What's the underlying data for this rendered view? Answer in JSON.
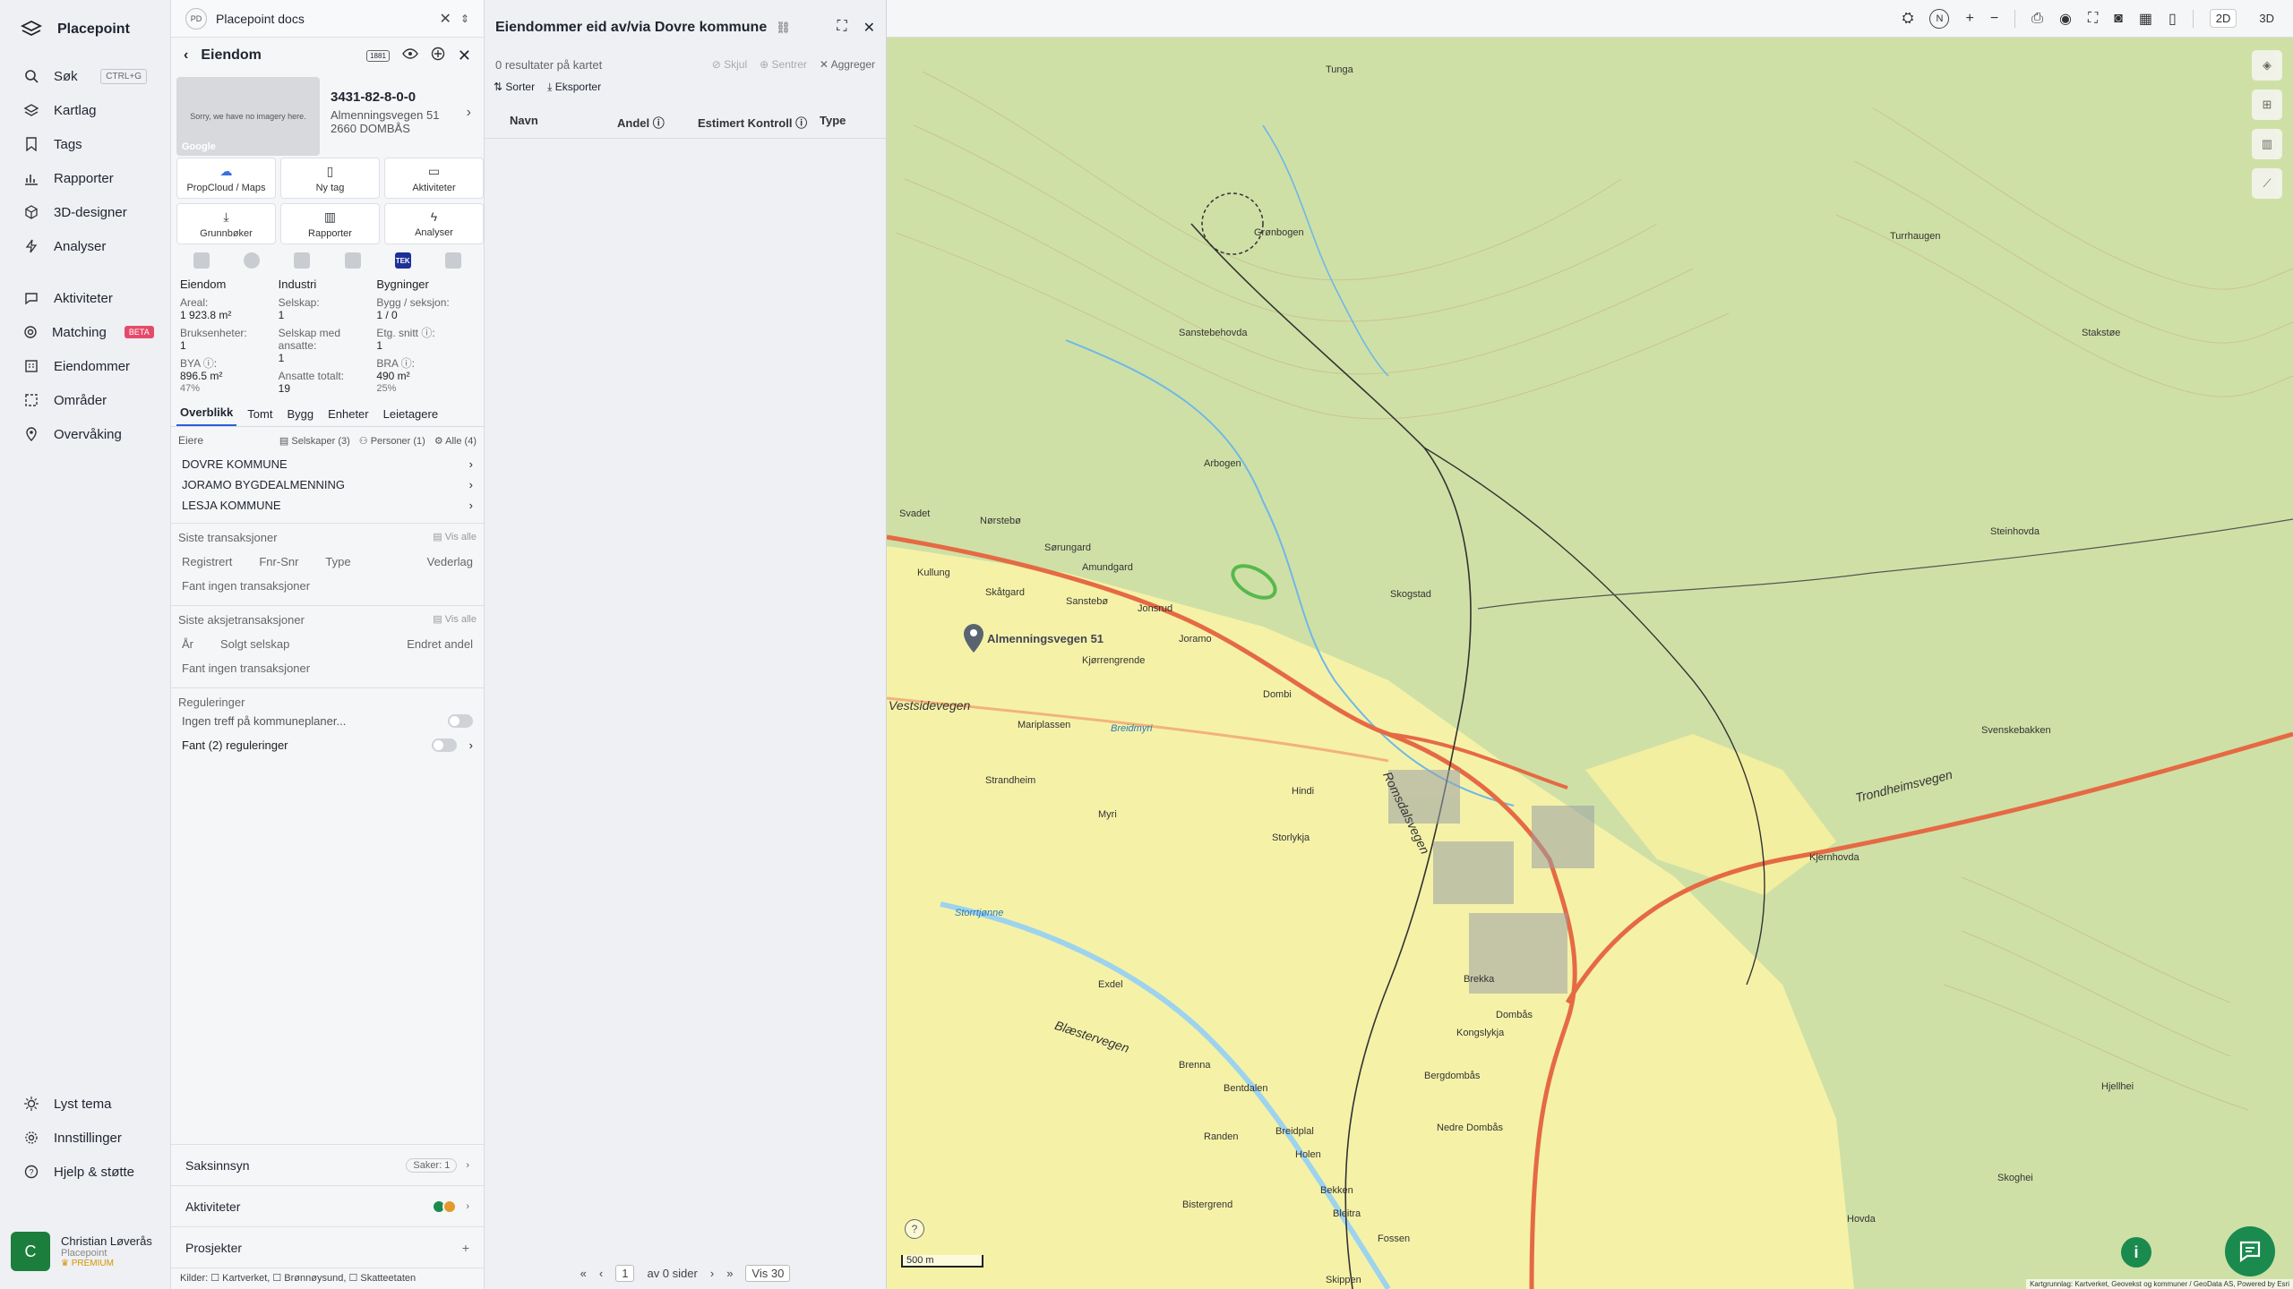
{
  "nav": {
    "brand": "Placepoint",
    "items": [
      {
        "label": "Søk",
        "shortcut": "CTRL+G"
      },
      {
        "label": "Kartlag"
      },
      {
        "label": "Tags"
      },
      {
        "label": "Rapporter"
      },
      {
        "label": "3D-designer"
      },
      {
        "label": "Analyser"
      },
      {
        "label": "Aktiviteter"
      },
      {
        "label": "Matching",
        "badge": "BETA"
      },
      {
        "label": "Eiendommer"
      },
      {
        "label": "Områder"
      },
      {
        "label": "Overvåking"
      }
    ],
    "bottom": [
      {
        "label": "Lyst tema"
      },
      {
        "label": "Innstillinger"
      },
      {
        "label": "Hjelp & støtte"
      }
    ],
    "user": {
      "initial": "C",
      "name": "Christian Løverås",
      "org": "Placepoint",
      "plan": "PREMIUM"
    }
  },
  "docs": {
    "badge": "PD",
    "title": "Placepoint docs"
  },
  "property": {
    "header": "Eiendom",
    "header_badge": "1881",
    "photo_text": "Sorry, we have no imagery here.",
    "photo_google": "Google",
    "id": "3431-82-8-0-0",
    "address_line1": "Almenningsvegen 51",
    "address_line2": "2660 DOMBÅS",
    "actions": [
      {
        "label": "PropCloud / Maps",
        "icon": "cloud-icon"
      },
      {
        "label": "Ny tag",
        "icon": "bookmark-icon"
      },
      {
        "label": "Aktiviteter",
        "icon": "chat-icon"
      },
      {
        "label": "Grunnbøker",
        "icon": "download-icon"
      },
      {
        "label": "Rapporter",
        "icon": "chart-icon"
      },
      {
        "label": "Analyser",
        "icon": "bolt-icon"
      }
    ],
    "logos": [
      "",
      "",
      "",
      "",
      "TEK",
      ""
    ],
    "stats": {
      "eiendom": {
        "header": "Eiendom",
        "areal_label": "Areal:",
        "areal_value": "1 923.8 m²",
        "bruks_label": "Bruksenheter:",
        "bruks_value": "1",
        "bya_label": "BYA ⓘ:",
        "bya_value": "896.5 m²",
        "bya_pct": "47%"
      },
      "industri": {
        "header": "Industri",
        "selskap_label": "Selskap:",
        "selskap_value": "1",
        "ansatte_label": "Selskap med ansatte:",
        "ansatte_value": "1",
        "total_label": "Ansatte totalt:",
        "total_value": "19"
      },
      "bygninger": {
        "header": "Bygninger",
        "bygg_label": "Bygg / seksjon:",
        "bygg_value": "1 / 0",
        "etg_label": "Etg. snitt ⓘ:",
        "etg_value": "1",
        "bra_label": "BRA ⓘ:",
        "bra_value": "490 m²",
        "bra_pct": "25%"
      }
    },
    "tabs": [
      "Overblikk",
      "Tomt",
      "Bygg",
      "Enheter",
      "Leietagere"
    ],
    "owners_label": "Eiere",
    "owner_filters": [
      "Selskaper (3)",
      "Personer (1)",
      "Alle (4)"
    ],
    "owners": [
      "DOVRE KOMMUNE",
      "JORAMO BYGDEALMENNING",
      "LESJA KOMMUNE"
    ],
    "transactions": {
      "title": "Siste transaksjoner",
      "view_all": "Vis alle",
      "cols": [
        "Registrert",
        "Fnr-Snr",
        "Type",
        "Vederlag"
      ],
      "empty": "Fant ingen transaksjoner"
    },
    "share_transactions": {
      "title": "Siste aksjetransaksjoner",
      "view_all": "Vis alle",
      "cols": [
        "År",
        "Solgt selskap",
        "Endret andel"
      ],
      "empty": "Fant ingen transaksjoner"
    },
    "regulations": {
      "title": "Reguleringer",
      "row1": "Ingen treff på kommuneplaner...",
      "row2": "Fant (2) reguleringer"
    },
    "bottom": [
      {
        "label": "Saksinnsyn",
        "right": "Saker: 1"
      },
      {
        "label": "Aktiviteter"
      },
      {
        "label": "Prosjekter",
        "right": "+"
      }
    ],
    "sources": "Kilder: ☐ Kartverket, ☐ Brønnøysund, ☐ Skatteetaten"
  },
  "results": {
    "title": "Eiendommer eid av/via Dovre kommune",
    "count": "0 resultater på kartet",
    "skjul": "Skjul",
    "sentrer": "Sentrer",
    "aggreger": "Aggreger",
    "sorter": "Sorter",
    "eksporter": "Eksporter",
    "columns": [
      "Navn",
      "Andel ⓘ",
      "Estimert Kontroll ⓘ",
      "Type"
    ],
    "pager": {
      "page": "1",
      "of": "av 0 sider",
      "per_page": "Vis 30"
    }
  },
  "map": {
    "modes": [
      "2D",
      "3D"
    ],
    "north": "N",
    "scale": "500 m",
    "attribution": "Kartgrunnlag: Kartverket, Geovekst og kommuner / GeoData AS, Powered by Esri",
    "info": "i",
    "help": "?",
    "marker_label": "Almenningsvegen 51",
    "labels": [
      {
        "t": "Tunga"
      },
      {
        "t": "Grønbogen"
      },
      {
        "t": "Turrhaugen"
      },
      {
        "t": "Sanstebehovda"
      },
      {
        "t": "Stakstøe"
      },
      {
        "t": "Arbogen"
      },
      {
        "t": "Steinhovda"
      },
      {
        "t": "Svadet"
      },
      {
        "t": "Nørstebø"
      },
      {
        "t": "Sørungard"
      },
      {
        "t": "Amundgard"
      },
      {
        "t": "Kullung"
      },
      {
        "t": "Skåtgard"
      },
      {
        "t": "Sanstebø"
      },
      {
        "t": "Jonsrud"
      },
      {
        "t": "Skogstad"
      },
      {
        "t": "Joramo"
      },
      {
        "t": "Kjørrengrende"
      },
      {
        "t": "Dombi"
      },
      {
        "t": "Svenskebakken"
      },
      {
        "t": "Vestsidevegen"
      },
      {
        "t": "Mariplassen"
      },
      {
        "t": "Breidmyri"
      },
      {
        "t": "Strandheim"
      },
      {
        "t": "Hindi"
      },
      {
        "t": "Trondheimsvegen"
      },
      {
        "t": "Myri"
      },
      {
        "t": "Storlykja"
      },
      {
        "t": "Romsdalsvegen"
      },
      {
        "t": "Kjernhovda"
      },
      {
        "t": "Storrtjønne"
      },
      {
        "t": "Exdel"
      },
      {
        "t": "Brekka"
      },
      {
        "t": "Dombås"
      },
      {
        "t": "Blæstervegen"
      },
      {
        "t": "Kongslykja"
      },
      {
        "t": "Bergdombås"
      },
      {
        "t": "Brenna"
      },
      {
        "t": "Bentdalen"
      },
      {
        "t": "Randen"
      },
      {
        "t": "Breidplal"
      },
      {
        "t": "Holen"
      },
      {
        "t": "Nedre Dombås"
      },
      {
        "t": "Hjellhei"
      },
      {
        "t": "Skoghei"
      },
      {
        "t": "Hovda"
      },
      {
        "t": "Bistergrend"
      },
      {
        "t": "Bekken"
      },
      {
        "t": "Bleitra"
      },
      {
        "t": "Fossen"
      },
      {
        "t": "Skippen"
      },
      {
        "t": "Joramo"
      }
    ]
  }
}
